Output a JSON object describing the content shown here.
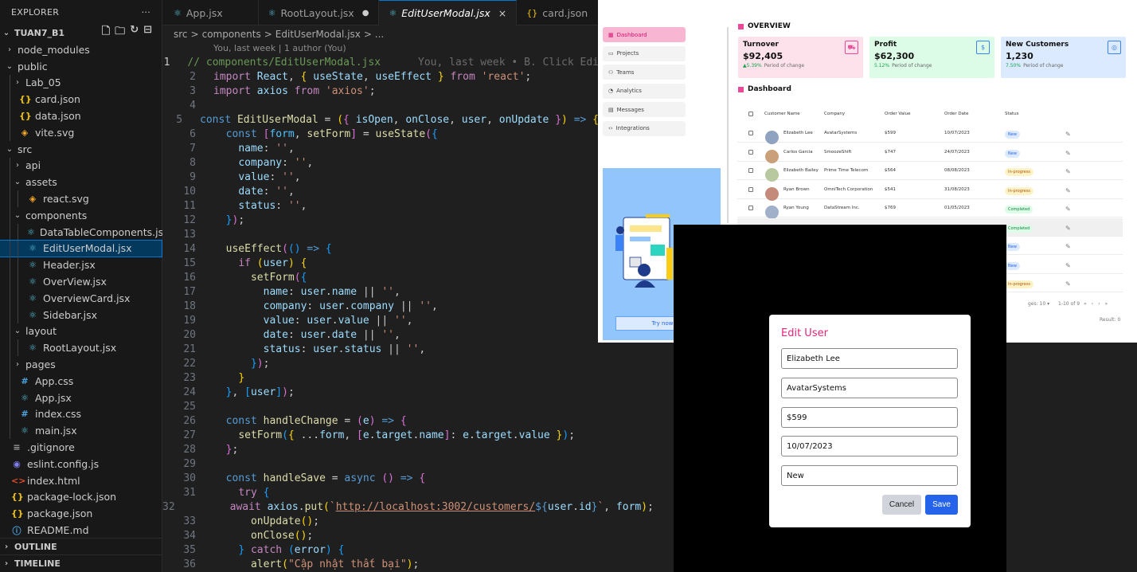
{
  "explorer": {
    "title": "EXPLORER",
    "more": "···",
    "project": "TUAN7_B1",
    "tree": [
      {
        "label": "node_modules",
        "type": "folder-closed",
        "depth": 1
      },
      {
        "label": "public",
        "type": "folder-open",
        "depth": 1
      },
      {
        "label": "Lab_05",
        "type": "folder-closed",
        "depth": 2
      },
      {
        "label": "card.json",
        "type": "json",
        "depth": 2
      },
      {
        "label": "data.json",
        "type": "json",
        "depth": 2
      },
      {
        "label": "vite.svg",
        "type": "svg",
        "depth": 2
      },
      {
        "label": "src",
        "type": "folder-open",
        "depth": 1
      },
      {
        "label": "api",
        "type": "folder-closed",
        "depth": 2
      },
      {
        "label": "assets",
        "type": "folder-open",
        "depth": 2
      },
      {
        "label": "react.svg",
        "type": "svg",
        "depth": 3
      },
      {
        "label": "components",
        "type": "folder-open",
        "depth": 2
      },
      {
        "label": "DataTableComponents.jsx",
        "type": "react",
        "depth": 3
      },
      {
        "label": "EditUserModal.jsx",
        "type": "react",
        "depth": 3,
        "selected": true
      },
      {
        "label": "Header.jsx",
        "type": "react",
        "depth": 3
      },
      {
        "label": "OverView.jsx",
        "type": "react",
        "depth": 3
      },
      {
        "label": "OverviewCard.jsx",
        "type": "react",
        "depth": 3
      },
      {
        "label": "Sidebar.jsx",
        "type": "react",
        "depth": 3
      },
      {
        "label": "layout",
        "type": "folder-open",
        "depth": 2
      },
      {
        "label": "RootLayout.jsx",
        "type": "react",
        "depth": 3
      },
      {
        "label": "pages",
        "type": "folder-closed",
        "depth": 2
      },
      {
        "label": "App.css",
        "type": "css",
        "depth": 2
      },
      {
        "label": "App.jsx",
        "type": "react",
        "depth": 2
      },
      {
        "label": "index.css",
        "type": "css",
        "depth": 2
      },
      {
        "label": "main.jsx",
        "type": "react",
        "depth": 2
      },
      {
        "label": ".gitignore",
        "type": "git",
        "depth": 1
      },
      {
        "label": "eslint.config.js",
        "type": "eslint",
        "depth": 1
      },
      {
        "label": "index.html",
        "type": "html",
        "depth": 1
      },
      {
        "label": "package-lock.json",
        "type": "json",
        "depth": 1
      },
      {
        "label": "package.json",
        "type": "json",
        "depth": 1
      },
      {
        "label": "README.md",
        "type": "info",
        "depth": 1
      }
    ],
    "outline": "OUTLINE",
    "timeline": "TIMELINE"
  },
  "editor": {
    "tabs": [
      {
        "label": "App.jsx",
        "icon": "react",
        "status": ""
      },
      {
        "label": "RootLayout.jsx",
        "icon": "react",
        "status": "●"
      },
      {
        "label": "EditUserModal.jsx",
        "icon": "react",
        "status": "×",
        "active": true
      },
      {
        "label": "card.json",
        "icon": "json",
        "status": ""
      }
    ],
    "breadcrumb": [
      "src",
      ">",
      "components",
      ">",
      "EditUserModal.jsx",
      "> ..."
    ],
    "codelens": "You, last week | 1 author (You)",
    "blame": "You, last week • B. Click Edi",
    "current_line": 1
  },
  "dashboard": {
    "nav": [
      "Dashboard",
      "Projects",
      "Teams",
      "Analytics",
      "Messages",
      "Integrations"
    ],
    "promo_button": "Try now",
    "overview_title": "OVERVIEW",
    "cards": [
      {
        "title": "Turnover",
        "value": "$92,405",
        "change": "▲5.39%",
        "period": "Period of change",
        "bg": "#fde2ec",
        "accent": "#ec4899",
        "icon": "cart-icon"
      },
      {
        "title": "Profit",
        "value": "$62,300",
        "change": "5.12%",
        "period": "Period of change",
        "bg": "#dcfce7",
        "accent": "#3b82f6",
        "icon": "dollar-icon"
      },
      {
        "title": "New Customers",
        "value": "1,230",
        "change": "7.50%",
        "period": "Period of change",
        "bg": "#dbeafe",
        "accent": "#3b82f6",
        "icon": "user-icon"
      }
    ],
    "dashboard_title": "Dashboard",
    "columns": [
      "Customer Name",
      "Company",
      "Order Value",
      "Order Date",
      "Status"
    ],
    "rows": [
      {
        "name": "Elizabeth Lee",
        "company": "AvatarSystems",
        "value": "$599",
        "date": "10/07/2023",
        "status": "New",
        "kind": "new"
      },
      {
        "name": "Carlos Garcia",
        "company": "SmoozeShift",
        "value": "$747",
        "date": "24/07/2023",
        "status": "New",
        "kind": "new"
      },
      {
        "name": "Elizabeth Bailey",
        "company": "Prime Time Telecom",
        "value": "$564",
        "date": "08/08/2023",
        "status": "In-progress",
        "kind": "prog"
      },
      {
        "name": "Ryan Brown",
        "company": "OmniTech Corporation",
        "value": "$541",
        "date": "31/08/2023",
        "status": "In-progress",
        "kind": "prog"
      },
      {
        "name": "Ryan Young",
        "company": "DataStream Inc.",
        "value": "$769",
        "date": "01/05/2023",
        "status": "Completed",
        "kind": "done"
      },
      {
        "name": "",
        "company": "",
        "value": "",
        "date": "",
        "status": "Completed",
        "kind": "done"
      },
      {
        "name": "",
        "company": "",
        "value": "",
        "date": "",
        "status": "New",
        "kind": "new"
      },
      {
        "name": "",
        "company": "",
        "value": "",
        "date": "",
        "status": "New",
        "kind": "new"
      },
      {
        "name": "",
        "company": "",
        "value": "",
        "date": "",
        "status": "In-progress",
        "kind": "prog"
      }
    ],
    "pager": {
      "rows_label": "ges: 10 ▾",
      "range": "1-10 of 9",
      "result": "Result: 0"
    }
  },
  "modal": {
    "title": "Edit User",
    "fields": [
      "Elizabeth Lee",
      "AvatarSystems",
      "$599",
      "10/07/2023",
      "New"
    ],
    "cancel": "Cancel",
    "save": "Save"
  }
}
